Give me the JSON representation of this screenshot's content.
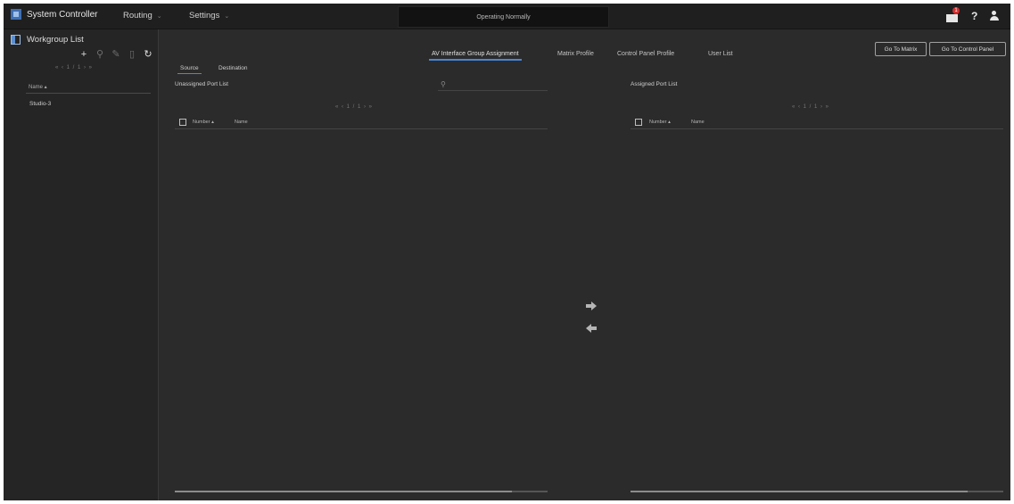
{
  "topbar": {
    "app_title": "System Controller",
    "menu": [
      {
        "label": "Routing"
      },
      {
        "label": "Settings"
      }
    ],
    "mode": "Operating Normally",
    "mail_badge": "1",
    "help_label": "?"
  },
  "sidebar": {
    "title": "Workgroup List",
    "pager": "« ‹ 1 / 1 › »",
    "column_header": "Name ▴",
    "items": [
      {
        "label": "Studio-3"
      }
    ]
  },
  "tabs": [
    {
      "label": "AV Interface Group Assignment",
      "active": true
    },
    {
      "label": "Matrix Profile"
    },
    {
      "label": "Control Panel Profile"
    },
    {
      "label": "User List"
    }
  ],
  "buttons": {
    "go_to_matrix": "Go To Matrix",
    "go_to_control_panel": "Go To Control Panel"
  },
  "subtabs": [
    {
      "label": "Source",
      "active": true
    },
    {
      "label": "Destination"
    }
  ],
  "unassigned": {
    "title": "Unassigned Port List",
    "pager": "« ‹ 1 / 1 › »",
    "columns": [
      "Number ▴",
      "Name"
    ],
    "rows": []
  },
  "assigned": {
    "title": "Assigned Port List",
    "pager": "« ‹ 1 / 1 › »",
    "columns": [
      "Number ▴",
      "Name"
    ],
    "rows": []
  },
  "colors": {
    "background": "#2b2b2b",
    "topbar": "#1f1f1f",
    "accent": "#4a86d6",
    "badge": "#d32f2f"
  }
}
